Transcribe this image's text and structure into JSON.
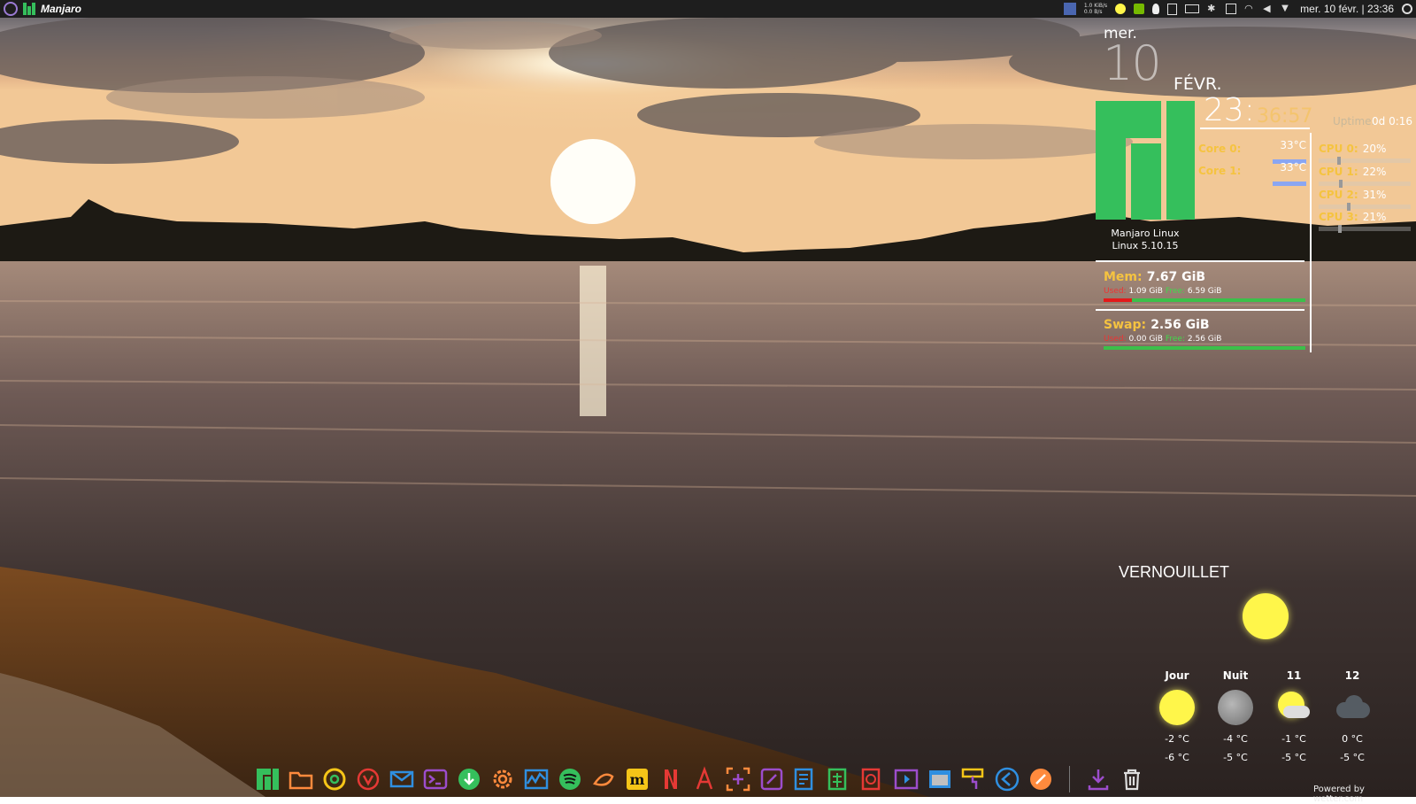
{
  "panel": {
    "app_title": "Manjaro",
    "net_up": "1.0 KiB/s",
    "net_down": "0.0 B/s",
    "clock": "mer. 10 févr. | 23:36",
    "icons": [
      "menu-icon",
      "manjaro-icon",
      "workspace-icon",
      "network-speed-icon",
      "weather-sun-icon",
      "nvidia-icon",
      "bulb-icon",
      "clipboard-icon",
      "battery-icon",
      "bluetooth-icon",
      "download-icon",
      "wifi-icon",
      "volume-icon",
      "chevron-down-icon",
      "search-icon"
    ]
  },
  "conky": {
    "day_name": "mer.",
    "day_num": "10",
    "month": "FÉVR.",
    "time_hm": "23:",
    "time_ms": "36:57",
    "uptime_label": "Uptime:",
    "uptime_value": "0d 0:16",
    "distro": "Manjaro Linux",
    "kernel": "Linux 5.10.15",
    "cores": [
      {
        "label": "Core 0:",
        "temp": "33°C"
      },
      {
        "label": "Core 1:",
        "temp": "33°C"
      }
    ],
    "cpus": [
      {
        "label": "CPU 0:",
        "pct": "20%",
        "value": 0.2
      },
      {
        "label": "CPU 1:",
        "pct": "22%",
        "value": 0.22
      },
      {
        "label": "CPU 2:",
        "pct": "31%",
        "value": 0.31
      },
      {
        "label": "CPU 3:",
        "pct": "21%",
        "value": 0.21
      }
    ],
    "mem": {
      "label": "Mem:",
      "total": "7.67 GiB",
      "used_label": "Used:",
      "used": "1.09 GiB",
      "free_label": "Free:",
      "free": "6.59 GiB",
      "used_fraction": 0.14
    },
    "swap": {
      "label": "Swap:",
      "total": "2.56 GiB",
      "used_label": "Used:",
      "used": "0.00 GiB",
      "free_label": "Free:",
      "free": "2.56 GiB",
      "used_fraction": 0.0
    }
  },
  "weather": {
    "city": "VERNOUILLET",
    "forecast": [
      {
        "label": "Jour",
        "icon": "sun-icon",
        "high": "-2 °C",
        "low": "-6 °C"
      },
      {
        "label": "Nuit",
        "icon": "moon-icon",
        "high": "-4 °C",
        "low": "-5 °C"
      },
      {
        "label": "11",
        "icon": "sun-cloud-icon",
        "high": "-1 °C",
        "low": "-5 °C"
      },
      {
        "label": "12",
        "icon": "cloud-icon",
        "high": "0 °C",
        "low": "-5 °C"
      }
    ],
    "credit": "Powered by wetter.com"
  },
  "dock": {
    "items": [
      "manjaro-settings",
      "file-manager",
      "chrome",
      "vivaldi",
      "mail",
      "terminal",
      "downloader",
      "system-settings",
      "system-monitor",
      "spotify",
      "pamac",
      "manjaro-m",
      "netflix",
      "text-editor",
      "screenshot",
      "notes",
      "office-writer",
      "office-calc",
      "office-impress",
      "kdenlive",
      "window-manager",
      "paint",
      "vscode",
      "compass",
      "downloads",
      "trash"
    ],
    "colors": {
      "green": "#35bf5c",
      "blue": "#2f8fe0",
      "red": "#e53935",
      "orange": "#ff8a3d",
      "purple": "#9c4dcc",
      "yellow": "#f5c518",
      "gray": "#c0c0c0"
    }
  }
}
